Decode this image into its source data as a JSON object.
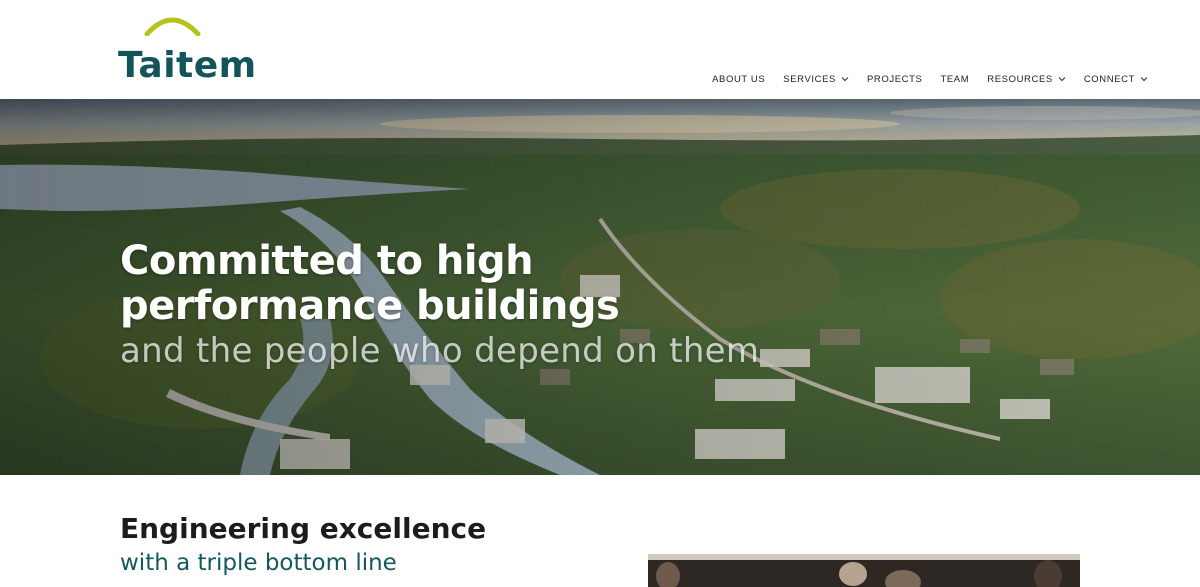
{
  "brand": {
    "name": "Taitem",
    "colors": {
      "arc": "#b8c21c",
      "text": "#13545a"
    }
  },
  "nav": {
    "items": [
      {
        "label": "ABOUT US",
        "has_dropdown": false
      },
      {
        "label": "SERVICES",
        "has_dropdown": true
      },
      {
        "label": "PROJECTS",
        "has_dropdown": false
      },
      {
        "label": "TEAM",
        "has_dropdown": false
      },
      {
        "label": "RESOURCES",
        "has_dropdown": true
      },
      {
        "label": "CONNECT",
        "has_dropdown": true
      }
    ]
  },
  "hero": {
    "line1": "Committed to high",
    "line2": "performance buildings",
    "line3": "and the people who depend on them"
  },
  "intro": {
    "title": "Engineering excellence",
    "subtitle": "with a triple bottom line"
  },
  "colors": {
    "accent_teal": "#15595f",
    "nav_text": "#222222"
  }
}
